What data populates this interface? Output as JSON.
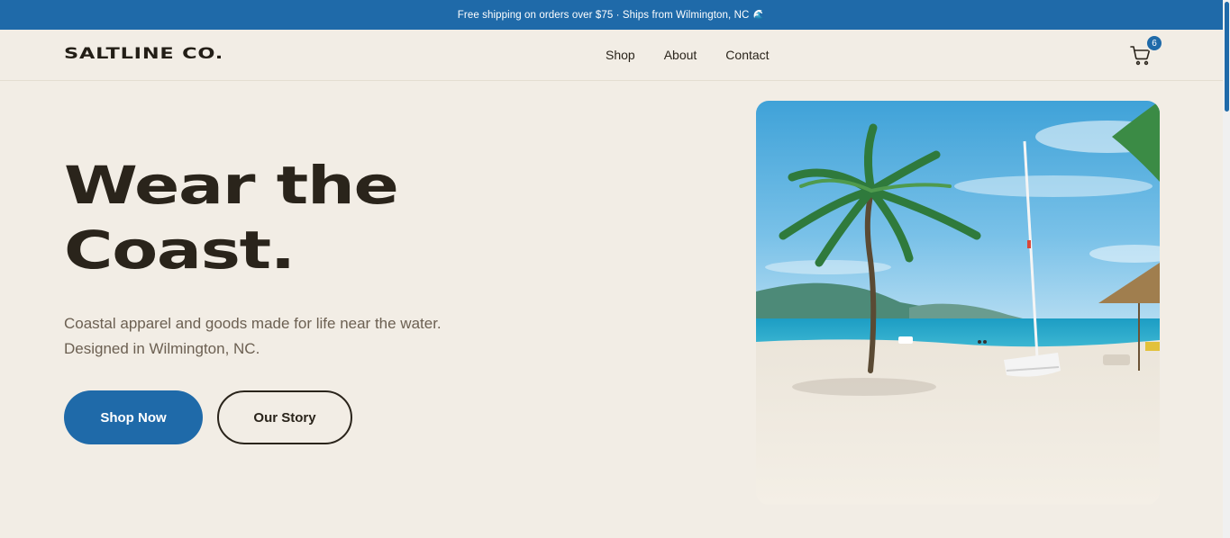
{
  "announcement": {
    "text": "Free shipping on orders over $75 · Ships from Wilmington, NC",
    "icon": "wave-icon"
  },
  "nav": {
    "logo": "SALTLINE CO.",
    "links": [
      "Shop",
      "About",
      "Contact"
    ],
    "cart_count": "6",
    "cart_icon": "cart-icon"
  },
  "hero": {
    "title_line1": "Wear the",
    "title_line2": "Coast.",
    "subtitle": "Coastal apparel and goods made for life near the water. Designed in Wilmington, NC.",
    "primary_button": "Shop Now",
    "secondary_button": "Our Story"
  },
  "colors": {
    "accent": "#1f6aa9",
    "background": "#f2ede5",
    "text": "#2a241b"
  }
}
